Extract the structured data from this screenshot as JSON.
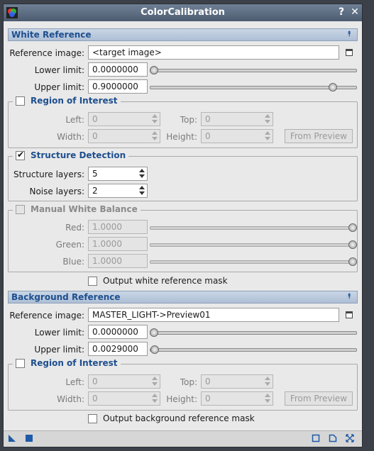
{
  "window": {
    "title": "ColorCalibration",
    "help_glyph": "?",
    "close_glyph": "✕"
  },
  "white_reference": {
    "section_title": "White Reference",
    "collapse_glyph": "⯭",
    "reference_image_label": "Reference image:",
    "reference_image_value": "<target image>",
    "lower_limit_label": "Lower limit:",
    "lower_limit_value": "0.0000000",
    "lower_limit_slider_fraction": 0.0,
    "upper_limit_label": "Upper limit:",
    "upper_limit_value": "0.9000000",
    "upper_limit_slider_fraction": 0.9,
    "roi": {
      "title": "Region of Interest",
      "checked": false,
      "left_label": "Left:",
      "left_value": "0",
      "top_label": "Top:",
      "top_value": "0",
      "width_label": "Width:",
      "width_value": "0",
      "height_label": "Height:",
      "height_value": "0",
      "from_preview_label": "From Preview"
    },
    "structure": {
      "title": "Structure Detection",
      "checked": true,
      "checkmark": "✔",
      "structure_layers_label": "Structure layers:",
      "structure_layers_value": "5",
      "noise_layers_label": "Noise layers:",
      "noise_layers_value": "2"
    },
    "manual_wb": {
      "title": "Manual White Balance",
      "checked": false,
      "red_label": "Red:",
      "red_value": "1.0000",
      "red_fraction": 1.0,
      "green_label": "Green:",
      "green_value": "1.0000",
      "green_fraction": 1.0,
      "blue_label": "Blue:",
      "blue_value": "1.0000",
      "blue_fraction": 1.0
    },
    "output_mask_label": "Output white reference mask"
  },
  "background_reference": {
    "section_title": "Background Reference",
    "collapse_glyph": "⯭",
    "reference_image_label": "Reference image:",
    "reference_image_value": "MASTER_LIGHT->Preview01",
    "lower_limit_label": "Lower limit:",
    "lower_limit_value": "0.0000000",
    "lower_limit_slider_fraction": 0.0,
    "upper_limit_label": "Upper limit:",
    "upper_limit_value": "0.0029000",
    "upper_limit_slider_fraction": 0.003,
    "roi": {
      "title": "Region of Interest",
      "checked": false,
      "left_label": "Left:",
      "left_value": "0",
      "top_label": "Top:",
      "top_value": "0",
      "width_label": "Width:",
      "width_value": "0",
      "height_label": "Height:",
      "height_value": "0",
      "from_preview_label": "From Preview"
    },
    "output_mask_label": "Output background reference mask"
  },
  "colors": {
    "accent": "#1e4f8f",
    "titlebar": "#5b6b80"
  },
  "bottom_icons": [
    "new-instance-icon",
    "apply-icon",
    "reset-icon",
    "edit-instructions-icon",
    "preview-icon"
  ]
}
